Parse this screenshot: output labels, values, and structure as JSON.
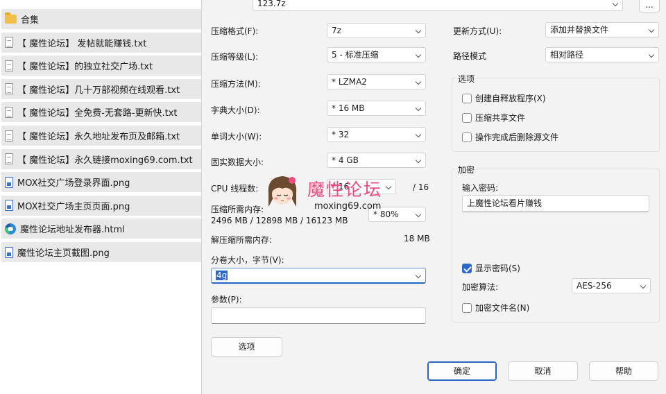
{
  "file_list": [
    {
      "icon": "folder-icon",
      "kind": "folder",
      "name": "合集"
    },
    {
      "icon": "text-file-icon",
      "kind": "txt",
      "name": "【 魔性论坛】 发帖就能赚钱.txt"
    },
    {
      "icon": "text-file-icon",
      "kind": "txt",
      "name": "【 魔性论坛】的独立社交广场.txt"
    },
    {
      "icon": "text-file-icon",
      "kind": "txt",
      "name": "【 魔性论坛】几十万部视频在线观看.txt"
    },
    {
      "icon": "text-file-icon",
      "kind": "txt",
      "name": "【 魔性论坛】全免费-无套路-更新快.txt"
    },
    {
      "icon": "text-file-icon",
      "kind": "txt",
      "name": "【 魔性论坛】永久地址发布页及邮箱.txt"
    },
    {
      "icon": "text-file-icon",
      "kind": "txt",
      "name": "【 魔性论坛】永久链接moxing69.com.txt"
    },
    {
      "icon": "image-file-icon",
      "kind": "png",
      "name": "MOX社交广场登录界面.png"
    },
    {
      "icon": "image-file-icon",
      "kind": "png",
      "name": "MOX社交广场主页页面.png"
    },
    {
      "icon": "edge-browser-icon",
      "kind": "edge",
      "name": "魔性论坛地址发布器.html"
    },
    {
      "icon": "image-file-icon",
      "kind": "png",
      "name": "魔性论坛主页截图.png"
    }
  ],
  "archive": {
    "path": "123.7z",
    "browse_label": "..."
  },
  "left": {
    "format_label": "压缩格式(F):",
    "format_value": "7z",
    "level_label": "压缩等级(L):",
    "level_value": "5 - 标准压缩",
    "method_label": "压缩方法(M):",
    "method_value": "* LZMA2",
    "dict_label": "字典大小(D):",
    "dict_value": "* 16 MB",
    "word_label": "单词大小(W):",
    "word_value": "* 32",
    "solid_label": "固实数据大小:",
    "solid_value": "* 4 GB",
    "threads_label": "CPU 线程数:",
    "threads_value": "* 16",
    "threads_total": "/ 16",
    "mem_label": "压缩所需内存:",
    "mem_detail": "2496 MB / 12898 MB / 16123 MB",
    "mem_value": "* 80%",
    "decomp_label": "解压缩所需内存:",
    "decomp_value": "18 MB",
    "split_label": "分卷大小，字节(V):",
    "split_value": "4g",
    "params_label": "参数(P):",
    "params_value": "",
    "options_button": "选项"
  },
  "right": {
    "update_label": "更新方式(U):",
    "update_value": "添加并替换文件",
    "path_label": "路径模式",
    "path_value": "相对路径",
    "options_group": "选项",
    "sfx_label": "创建自释放程序(X)",
    "sfx_checked": false,
    "shared_label": "压缩共享文件",
    "shared_checked": false,
    "delete_label": "操作完成后删除源文件",
    "delete_checked": false,
    "encrypt_group": "加密",
    "password_label": "输入密码:",
    "password_value": "上魔性论坛看片赚钱",
    "show_pw_label": "显示密码(S)",
    "show_pw_checked": true,
    "method_label": "加密算法:",
    "method_value": "AES-256",
    "encrypt_names_label": "加密文件名(N)",
    "encrypt_names_checked": false
  },
  "buttons": {
    "ok": "确定",
    "cancel": "取消",
    "help": "帮助"
  },
  "watermark": {
    "title": "魔性论坛",
    "url": "moxing69.com"
  },
  "colors": {
    "accent": "#2f66c8",
    "watermark": "#ee4b7f"
  }
}
